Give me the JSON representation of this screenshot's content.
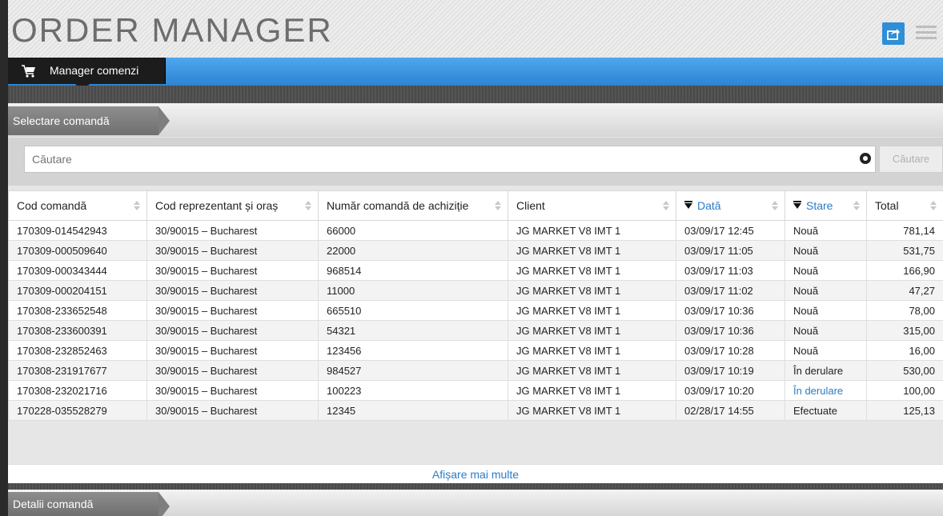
{
  "app": {
    "title": "ORDER MANAGER"
  },
  "nav": {
    "active_tab": "Manager comenzi"
  },
  "section_select": {
    "label": "Selectare comandă"
  },
  "search": {
    "placeholder": "Căutare",
    "button_label": "Căutare"
  },
  "table": {
    "headers": [
      "Cod comandă",
      "Cod reprezentant și oraș",
      "Număr comandă de achiziție",
      "Client",
      "Dată",
      "Stare",
      "Total"
    ],
    "rows": [
      [
        "170309-014542943",
        "30/90015 – Bucharest",
        "66000",
        "JG MARKET V8 IMT 1",
        "03/09/17 12:45",
        "Nouă",
        "781,14"
      ],
      [
        "170309-000509640",
        "30/90015 – Bucharest",
        "22000",
        "JG MARKET V8 IMT 1",
        "03/09/17 11:05",
        "Nouă",
        "531,75"
      ],
      [
        "170309-000343444",
        "30/90015 – Bucharest",
        "968514",
        "JG MARKET V8 IMT 1",
        "03/09/17 11:03",
        "Nouă",
        "166,90"
      ],
      [
        "170309-000204151",
        "30/90015 – Bucharest",
        "11000",
        "JG MARKET V8 IMT 1",
        "03/09/17 11:02",
        "Nouă",
        "47,27"
      ],
      [
        "170308-233652548",
        "30/90015 – Bucharest",
        "665510",
        "JG MARKET V8 IMT 1",
        "03/09/17 10:36",
        "Nouă",
        "78,00"
      ],
      [
        "170308-233600391",
        "30/90015 – Bucharest",
        "54321",
        "JG MARKET V8 IMT 1",
        "03/09/17 10:36",
        "Nouă",
        "315,00"
      ],
      [
        "170308-232852463",
        "30/90015 – Bucharest",
        "123456",
        "JG MARKET V8 IMT 1",
        "03/09/17 10:28",
        "Nouă",
        "16,00"
      ],
      [
        "170308-231917677",
        "30/90015 – Bucharest",
        "984527",
        "JG MARKET V8 IMT 1",
        "03/09/17 10:19",
        "În derulare",
        "530,00"
      ],
      [
        "170308-232021716",
        "30/90015 – Bucharest",
        "100223",
        "JG MARKET V8 IMT 1",
        "03/09/17 10:20",
        "În derulare",
        "100,00"
      ],
      [
        "170228-035528279",
        "30/90015 – Bucharest",
        "12345",
        "JG MARKET V8 IMT 1",
        "02/28/17 14:55",
        "Efectuate",
        "125,13"
      ]
    ],
    "show_more": "Afișare mai multe"
  },
  "section_details": {
    "label": "Detalii comandă"
  },
  "icons": {
    "nav_tab": "shopping-cart-icon",
    "export": "export-icon",
    "menu": "hamburger-menu-icon",
    "clear": "clear-search-icon",
    "filter": "filter-icon",
    "sort": "sort-icon"
  },
  "colors": {
    "accent": "#2a7cc7",
    "navbar": "#3a93e0",
    "active_tab": "#1c1c1c"
  }
}
